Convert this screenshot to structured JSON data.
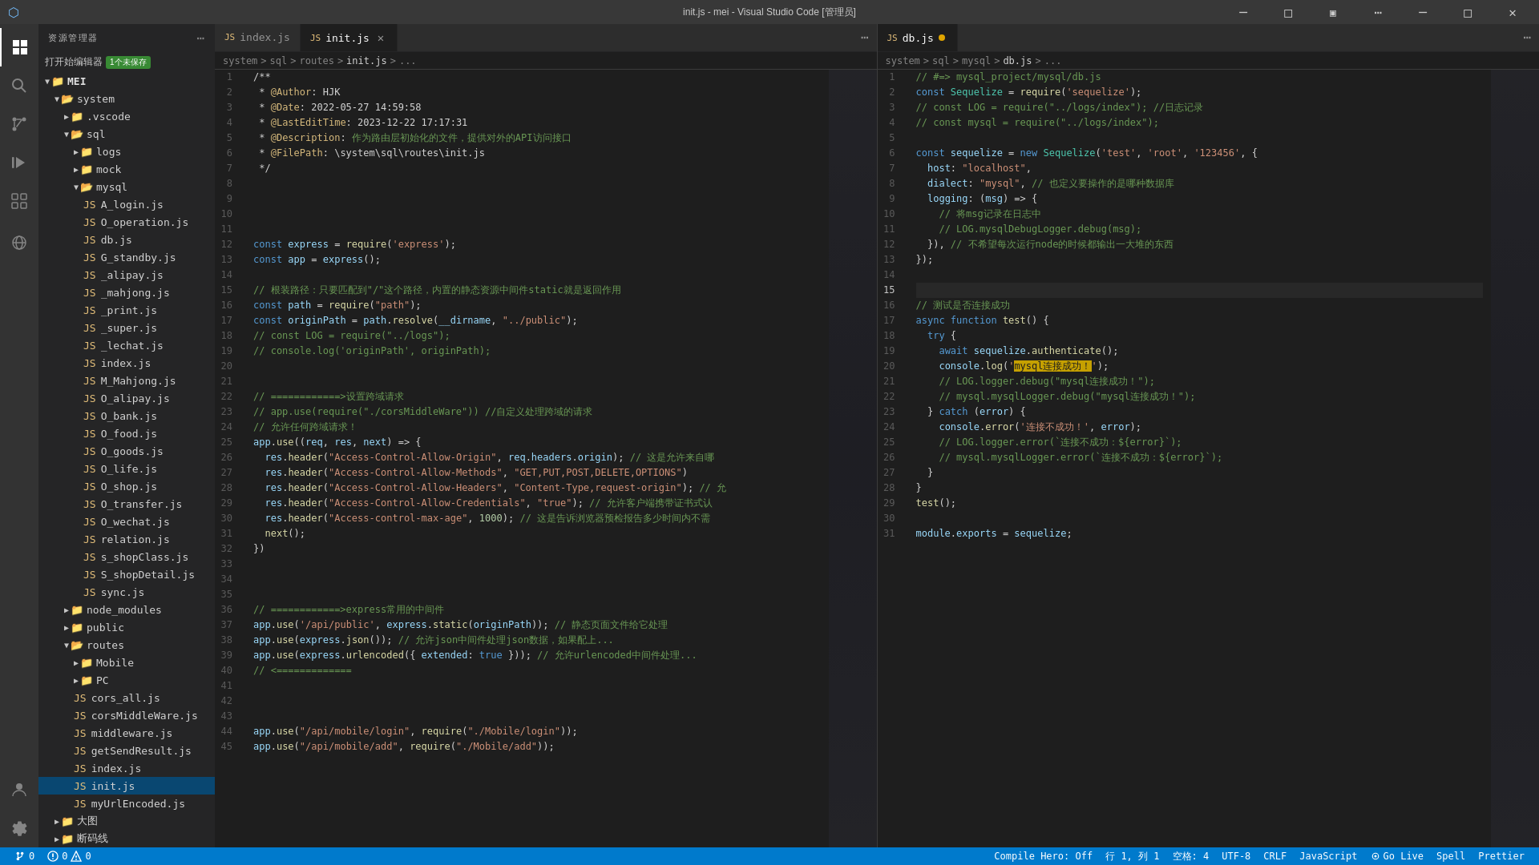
{
  "titlebar": {
    "title": "init.js - mei - Visual Studio Code [管理员]",
    "controls": [
      "minimize",
      "restore",
      "close"
    ]
  },
  "activity_bar": {
    "icons": [
      {
        "name": "explorer",
        "symbol": "⎘",
        "active": true
      },
      {
        "name": "search",
        "symbol": "🔍"
      },
      {
        "name": "source-control",
        "symbol": "⑃",
        "badge": ""
      },
      {
        "name": "run-debug",
        "symbol": "▷"
      },
      {
        "name": "extensions",
        "symbol": "⧉"
      },
      {
        "name": "remote-explorer",
        "symbol": "⊙"
      },
      {
        "name": "account",
        "symbol": "◯"
      },
      {
        "name": "settings",
        "symbol": "⚙"
      }
    ]
  },
  "sidebar": {
    "header": "资源管理器",
    "project": "MEI",
    "run_btn": "打开始编辑器",
    "run_badge": "1个未保存",
    "tree": [
      {
        "label": "system",
        "type": "folder",
        "indent": 1,
        "expanded": true
      },
      {
        "label": ".vscode",
        "type": "folder",
        "indent": 2,
        "expanded": false
      },
      {
        "label": "sql",
        "type": "folder",
        "indent": 2,
        "expanded": true
      },
      {
        "label": "logs",
        "type": "folder",
        "indent": 3,
        "expanded": false
      },
      {
        "label": "mock",
        "type": "folder",
        "indent": 3,
        "expanded": false
      },
      {
        "label": "mysql",
        "type": "folder",
        "indent": 3,
        "expanded": true
      },
      {
        "label": "A_login.js",
        "type": "file-js",
        "indent": 4
      },
      {
        "label": "O_operation.js",
        "type": "file-js",
        "indent": 4
      },
      {
        "label": "db.js",
        "type": "file-js",
        "indent": 4
      },
      {
        "label": "G_standby.js",
        "type": "file-js",
        "indent": 4
      },
      {
        "label": "_alipay.js",
        "type": "file-js",
        "indent": 4
      },
      {
        "label": "_mahjong.js",
        "type": "file-js",
        "indent": 4
      },
      {
        "label": "_print.js",
        "type": "file-js",
        "indent": 4
      },
      {
        "label": "_super.js",
        "type": "file-js",
        "indent": 4
      },
      {
        "label": "_lechat.js",
        "type": "file-js",
        "indent": 4
      },
      {
        "label": "index.js",
        "type": "file-js",
        "indent": 4
      },
      {
        "label": "M_Mahjong.js",
        "type": "file-js",
        "indent": 4
      },
      {
        "label": "O_alipay.js",
        "type": "file-js",
        "indent": 4
      },
      {
        "label": "O_bank.js",
        "type": "file-js",
        "indent": 4
      },
      {
        "label": "O_food.js",
        "type": "file-js",
        "indent": 4
      },
      {
        "label": "O_goods.js",
        "type": "file-js",
        "indent": 4
      },
      {
        "label": "O_life.js",
        "type": "file-js",
        "indent": 4
      },
      {
        "label": "O_shop.js",
        "type": "file-js",
        "indent": 4
      },
      {
        "label": "O_transfer.js",
        "type": "file-js",
        "indent": 4
      },
      {
        "label": "O_wechat.js",
        "type": "file-js",
        "indent": 4
      },
      {
        "label": "relation.js",
        "type": "file-js",
        "indent": 4
      },
      {
        "label": "s_shopClass.js",
        "type": "file-js",
        "indent": 4
      },
      {
        "label": "S_shopDetail.js",
        "type": "file-js",
        "indent": 4
      },
      {
        "label": "sync.js",
        "type": "file-js",
        "indent": 4
      },
      {
        "label": "node_modules",
        "type": "folder",
        "indent": 2,
        "expanded": false
      },
      {
        "label": "public",
        "type": "folder",
        "indent": 2,
        "expanded": false
      },
      {
        "label": "routes",
        "type": "folder",
        "indent": 2,
        "expanded": true
      },
      {
        "label": "Mobile",
        "type": "folder",
        "indent": 3,
        "expanded": false
      },
      {
        "label": "PC",
        "type": "folder",
        "indent": 3,
        "expanded": false
      },
      {
        "label": "cors_all.js",
        "type": "file-js",
        "indent": 3
      },
      {
        "label": "corsMiddleWare.js",
        "type": "file-js",
        "indent": 3
      },
      {
        "label": "middleware.js",
        "type": "file-js",
        "indent": 3
      },
      {
        "label": "getSendResult.js",
        "type": "file-js",
        "indent": 3
      },
      {
        "label": "index.js",
        "type": "file-js",
        "indent": 3
      },
      {
        "label": "init.js",
        "type": "file-js",
        "indent": 3,
        "selected": true
      },
      {
        "label": "myUrlEncoded.js",
        "type": "file-js",
        "indent": 3
      },
      {
        "label": "大图",
        "type": "folder",
        "indent": 1,
        "expanded": false
      },
      {
        "label": "断码线",
        "type": "folder",
        "indent": 1,
        "expanded": false
      }
    ]
  },
  "tabs_left": [
    {
      "label": "index.js",
      "active": false,
      "icon": "js"
    },
    {
      "label": "init.js",
      "active": true,
      "icon": "js",
      "closeable": true
    }
  ],
  "tabs_right": [
    {
      "label": "db.js",
      "active": true,
      "icon": "js",
      "modified": true
    }
  ],
  "breadcrumb_left": "system > sql > routes > init.js > ...",
  "breadcrumb_right": "system > sql > mysql > db.js > ...",
  "editor_left": {
    "lines": [
      {
        "n": 1,
        "code": "/**"
      },
      {
        "n": 2,
        "code": " * <span class='str2'>@Author</span>: HJK"
      },
      {
        "n": 3,
        "code": " * <span class='str2'>@Date</span>: 2022-05-27 14:59:58"
      },
      {
        "n": 4,
        "code": " * <span class='str2'>@LastEditTime</span>: 2023-12-22 17:17:31"
      },
      {
        "n": 5,
        "code": " * <span class='str2'>@Description</span>: <span class='comment'>作为路由层初始化的文件，提供对外的API访问接口</span>"
      },
      {
        "n": 6,
        "code": " * <span class='str2'>@FilePath</span>: \\system\\sql\\routes\\init.js"
      },
      {
        "n": 7,
        "code": " */"
      },
      {
        "n": 8,
        "code": ""
      },
      {
        "n": 9,
        "code": ""
      },
      {
        "n": 10,
        "code": ""
      },
      {
        "n": 11,
        "code": ""
      },
      {
        "n": 12,
        "code": "<span class='kw'>const</span> <span class='var'>express</span> = <span class='fn'>require</span>(<span class='str'>'express'</span>);"
      },
      {
        "n": 13,
        "code": "<span class='kw'>const</span> <span class='var'>app</span> = <span class='var'>express</span>();"
      },
      {
        "n": 14,
        "code": ""
      },
      {
        "n": 15,
        "code": "<span class='comment'>// 根装路径：只要匹配到\"/\"这个路径，内置的静态资源中间件static就是返回作用</span>"
      },
      {
        "n": 16,
        "code": "<span class='kw'>const</span> <span class='var'>path</span> = <span class='fn'>require</span>(<span class='str'>\"path\"</span>);"
      },
      {
        "n": 17,
        "code": "<span class='kw'>const</span> <span class='var'>originPath</span> = <span class='var'>path</span>.<span class='fn'>resolve</span>(<span class='var'>__dirname</span>, <span class='str'>\"../public\"</span>);"
      },
      {
        "n": 18,
        "code": "<span class='comment'>// const LOG = require(\"../logs\");</span>"
      },
      {
        "n": 19,
        "code": "<span class='comment'>// console.log('originPath', originPath);</span>"
      },
      {
        "n": 20,
        "code": ""
      },
      {
        "n": 21,
        "code": ""
      },
      {
        "n": 22,
        "code": "<span class='comment'>// ============&gt;设置跨域请求</span>"
      },
      {
        "n": 23,
        "code": "<span class='comment'>// app.use(require(\"./corsMiddleWare\")) //自定义处理跨域的请求</span>"
      },
      {
        "n": 24,
        "code": "<span class='comment'>// 允许任何跨域请求！</span>"
      },
      {
        "n": 25,
        "code": "<span class='var'>app</span>.<span class='fn'>use</span>((<span class='param'>req</span>, <span class='param'>res</span>, <span class='param'>next</span>) => {"
      },
      {
        "n": 26,
        "code": "  <span class='var'>res</span>.<span class='fn'>header</span>(<span class='str'>\"Access-Control-Allow-Origin\"</span>, <span class='var'>req</span>.<span class='prop'>headers</span>.<span class='prop'>origin</span>); <span class='comment'>// 这是允许来自哪</span>"
      },
      {
        "n": 27,
        "code": "  <span class='var'>res</span>.<span class='fn'>header</span>(<span class='str'>\"Access-Control-Allow-Methods\"</span>, <span class='str'>\"GET,PUT,POST,DELETE,OPTIONS\"</span>)"
      },
      {
        "n": 28,
        "code": "  <span class='var'>res</span>.<span class='fn'>header</span>(<span class='str'>\"Access-Control-Allow-Headers\"</span>, <span class='str'>\"Content-Type,request-origin\"</span>); <span class='comment'>// 允</span>"
      },
      {
        "n": 29,
        "code": "  <span class='var'>res</span>.<span class='fn'>header</span>(<span class='str'>\"Access-Control-Allow-Credentials\"</span>, <span class='str'>\"true\"</span>); <span class='comment'>// 允许客户端携带证书式认</span>"
      },
      {
        "n": 30,
        "code": "  <span class='var'>res</span>.<span class='fn'>header</span>(<span class='str'>\"Access-control-max-age\"</span>, <span class='num'>1000</span>); <span class='comment'>// 这是告诉浏览器预检报告多少时间内不需</span>"
      },
      {
        "n": 31,
        "code": "  <span class='fn'>next</span>();"
      },
      {
        "n": 32,
        "code": "})"
      },
      {
        "n": 33,
        "code": ""
      },
      {
        "n": 34,
        "code": ""
      },
      {
        "n": 35,
        "code": ""
      },
      {
        "n": 36,
        "code": "<span class='comment'>// ============&gt;express常用的中间件</span>"
      },
      {
        "n": 37,
        "code": "<span class='var'>app</span>.<span class='fn'>use</span>(<span class='str'>'/api/public'</span>, <span class='var'>express</span>.<span class='fn'>static</span>(<span class='var'>originPath</span>)); <span class='comment'>// 静态页面文件给它处理</span>"
      },
      {
        "n": 38,
        "code": "<span class='var'>app</span>.<span class='fn'>use</span>(<span class='var'>express</span>.<span class='fn'>json</span>()); <span class='comment'>// 允许json中间件处理json数据，如果配上...</span>"
      },
      {
        "n": 39,
        "code": "<span class='var'>app</span>.<span class='fn'>use</span>(<span class='var'>express</span>.<span class='fn'>urlencoded</span>({ <span class='var'>extended</span>: <span class='kw'>true</span> })); <span class='comment'>// 允许urlencoded中间件处理...</span>"
      },
      {
        "n": 40,
        "code": "<span class='comment'>// &lt;=============</span>"
      },
      {
        "n": 41,
        "code": ""
      },
      {
        "n": 42,
        "code": ""
      },
      {
        "n": 43,
        "code": ""
      },
      {
        "n": 44,
        "code": "<span class='var'>app</span>.<span class='fn'>use</span>(<span class='str'>\"/api/mobile/login\"</span>, <span class='fn'>require</span>(<span class='str'>\"./Mobile/login\"</span>));"
      },
      {
        "n": 45,
        "code": "<span class='var'>app</span>.<span class='fn'>use</span>(<span class='str'>\"/api/mobile/add\"</span>, <span class='fn'>require</span>(<span class='str'>\"./Mobile/add\"</span>));"
      }
    ]
  },
  "editor_right": {
    "lines": [
      {
        "n": 1,
        "code": "<span class='comment'>// #=> mysql_project/mysql/db.js</span>"
      },
      {
        "n": 2,
        "code": "<span class='kw'>const</span> <span class='type'>Sequelize</span> = <span class='fn'>require</span>(<span class='str'>'sequelize'</span>);"
      },
      {
        "n": 3,
        "code": "<span class='comment'>// const LOG = require(\"../logs/index\"); //日志记录</span>"
      },
      {
        "n": 4,
        "code": "<span class='comment'>// const mysql = require(\"../logs/index\");</span>"
      },
      {
        "n": 5,
        "code": ""
      },
      {
        "n": 6,
        "code": "<span class='kw'>const</span> <span class='var'>sequelize</span> = <span class='kw'>new</span> <span class='type'>Sequelize</span>(<span class='str'>'test'</span>, <span class='str'>'root'</span>, <span class='str'>'123456'</span>, {"
      },
      {
        "n": 7,
        "code": "  <span class='prop'>host</span>: <span class='str'>\"localhost\"</span>,"
      },
      {
        "n": 8,
        "code": "  <span class='prop'>dialect</span>: <span class='str'>\"mysql\"</span>, <span class='comment'>// 也定义要操作的是哪种数据库</span>"
      },
      {
        "n": 9,
        "code": "  <span class='prop'>logging</span>: (<span class='param'>msg</span>) => {"
      },
      {
        "n": 10,
        "code": "    <span class='comment'>// 将msg记录在日志中</span>"
      },
      {
        "n": 11,
        "code": "    <span class='comment'>// LOG.mysqlDebugLogger.debug(msg);</span>"
      },
      {
        "n": 12,
        "code": "  }), <span class='comment'>// 不希望每次运行node的时候都输出一大堆的东西</span>"
      },
      {
        "n": 13,
        "code": "});"
      },
      {
        "n": 14,
        "code": ""
      },
      {
        "n": 15,
        "code": "",
        "active": true
      },
      {
        "n": 16,
        "code": "<span class='comment'>// 测试是否连接成功</span>"
      },
      {
        "n": 17,
        "code": "<span class='kw'>async</span> <span class='kw'>function</span> <span class='fn'>test</span>() {"
      },
      {
        "n": 18,
        "code": "  <span class='kw'>try</span> {"
      },
      {
        "n": 19,
        "code": "    <span class='kw'>await</span> <span class='var'>sequelize</span>.<span class='fn'>authenticate</span>();"
      },
      {
        "n": 20,
        "code": "    <span class='var'>console</span>.<span class='fn'>log</span>(<span class='str'>'<span class=\"highlight-yellow\">mysql连接成功！</span>'</span>);"
      },
      {
        "n": 21,
        "code": "    <span class='comment'>// LOG.logger.debug(\"mysql连接成功！\");</span>"
      },
      {
        "n": 22,
        "code": "    <span class='comment'>// mysql.mysqlLogger.debug(\"mysql连接成功！\");</span>"
      },
      {
        "n": 23,
        "code": "  } <span class='kw'>catch</span> (<span class='param'>error</span>) {"
      },
      {
        "n": 24,
        "code": "    <span class='var'>console</span>.<span class='fn'>error</span>(<span class='str'>'连接不成功！'</span>, <span class='var'>error</span>);"
      },
      {
        "n": 25,
        "code": "    <span class='comment'>// LOG.logger.error(`连接不成功：${error}`);</span>"
      },
      {
        "n": 26,
        "code": "    <span class='comment'>// mysql.mysqlLogger.error(`连接不成功：${error}`);</span>"
      },
      {
        "n": 27,
        "code": "  }"
      },
      {
        "n": 28,
        "code": "}"
      },
      {
        "n": 29,
        "code": "<span class='fn'>test</span>();"
      },
      {
        "n": 30,
        "code": ""
      },
      {
        "n": 31,
        "code": "<span class='var'>module</span>.<span class='prop'>exports</span> = <span class='var'>sequelize</span>;"
      }
    ]
  },
  "statusbar": {
    "branch": "0",
    "errors": "0",
    "warnings": "0",
    "line": "行 1, 列 1",
    "spaces": "空格: 4",
    "encoding": "UTF-8",
    "line_ending": "CRLF",
    "language": "JavaScript",
    "compile_hero": "Compile Hero: Off",
    "go_live": "Go Live",
    "spell": "Spell",
    "prettier": "Prettier"
  }
}
